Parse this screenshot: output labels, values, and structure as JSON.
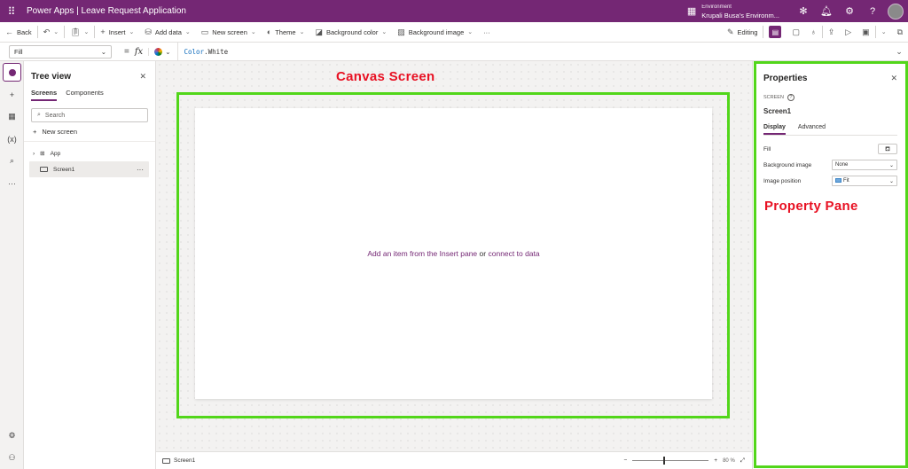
{
  "topbar": {
    "app_name": "Power Apps",
    "separator": "|",
    "document_title": "Leave Request Application",
    "environment_label": "Environment",
    "environment_name": "Krupali Busa's Environm..."
  },
  "commandbar": {
    "back": "Back",
    "insert": "Insert",
    "add_data": "Add data",
    "new_screen": "New screen",
    "theme": "Theme",
    "background_color": "Background color",
    "background_image": "Background image",
    "more": "···",
    "editing": "Editing"
  },
  "formulabar": {
    "property": "Fill",
    "equals": "=",
    "fx": "fx",
    "formula_object": "Color",
    "formula_member": ".White"
  },
  "treeview": {
    "title": "Tree view",
    "tabs": [
      "Screens",
      "Components"
    ],
    "search_placeholder": "Search",
    "new_screen": "New screen",
    "items": [
      {
        "label": "App"
      },
      {
        "label": "Screen1"
      }
    ],
    "more": "···"
  },
  "canvas": {
    "annotation": "Canvas Screen",
    "empty_prefix": "Add an item from the Insert pane",
    "empty_or": "or",
    "empty_link": "connect to data"
  },
  "statusbar": {
    "screen": "Screen1",
    "zoom_minus": "−",
    "zoom_plus": "+",
    "zoom_value": "80",
    "zoom_unit": "%",
    "zoom_level": 0.8
  },
  "properties": {
    "title": "Properties",
    "kind": "SCREEN",
    "name": "Screen1",
    "tabs": [
      "Display",
      "Advanced"
    ],
    "fill_label": "Fill",
    "background_image_label": "Background image",
    "background_image_value": "None",
    "image_position_label": "Image position",
    "image_position_value": "Fit",
    "annotation": "Property Pane"
  },
  "colors": {
    "brand": "#742774",
    "annotation_text": "#e81123",
    "annotation_border": "#52d61a"
  },
  "icons": [
    "waffle-icon",
    "environment-icon",
    "copilot-icon",
    "bell-icon",
    "gear-icon",
    "help-icon",
    "back-icon",
    "undo-icon",
    "redo-icon",
    "clipboard-icon",
    "plus-icon",
    "database-icon",
    "screen-icon",
    "theme-icon",
    "image-icon",
    "pencil-icon",
    "comment-icon",
    "stethoscope-icon",
    "share-icon",
    "play-icon",
    "save-icon",
    "publish-icon",
    "layers-icon",
    "table-icon",
    "variables-icon",
    "search-icon",
    "more-icon",
    "settings-icon",
    "account-icon",
    "close-icon",
    "chevron-down-icon",
    "fill-bucket-icon",
    "expand-icon"
  ]
}
